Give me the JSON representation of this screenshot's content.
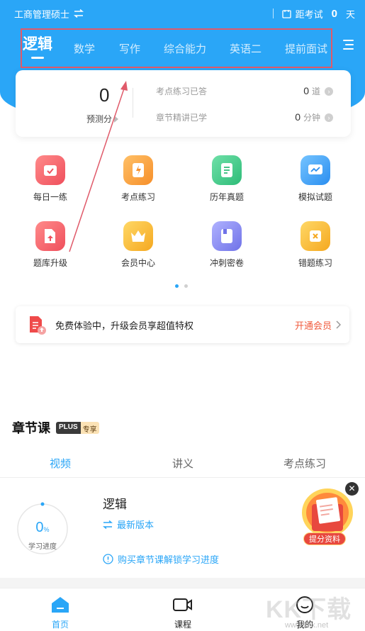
{
  "status_bar": {
    "major": "工商管理硕士",
    "exam_prefix": "距考试",
    "days_left": "0",
    "days_unit": "天"
  },
  "subject_tabs": [
    "逻辑",
    "数学",
    "写作",
    "综合能力",
    "英语二",
    "提前面试"
  ],
  "stats": {
    "predicted_score": "0",
    "predicted_label": "预测分",
    "practice_label": "考点练习已答",
    "practice_value": "0",
    "practice_unit": "道",
    "chapter_label": "章节精讲已学",
    "chapter_value": "0",
    "chapter_unit": "分钟"
  },
  "grid": [
    {
      "label": "每日一练",
      "icon": "calendar-check-icon",
      "color": "#f2626b"
    },
    {
      "label": "考点练习",
      "icon": "lightning-doc-icon",
      "color": "#f6a13a"
    },
    {
      "label": "历年真题",
      "icon": "document-icon",
      "color": "#3cc98a"
    },
    {
      "label": "模拟试题",
      "icon": "chart-screen-icon",
      "color": "#3aa2f5"
    },
    {
      "label": "题库升级",
      "icon": "upgrade-doc-icon",
      "color": "#f2626b"
    },
    {
      "label": "会员中心",
      "icon": "crown-icon",
      "color": "#f6b72a"
    },
    {
      "label": "冲刺密卷",
      "icon": "book-icon",
      "color": "#8a8cf0"
    },
    {
      "label": "错题练习",
      "icon": "cross-box-icon",
      "color": "#f6b72a"
    }
  ],
  "banner": {
    "text": "免费体验中，升级会员享超值特权",
    "button": "开通会员"
  },
  "chapter": {
    "title": "章节课",
    "badge_left": "PLUS",
    "badge_right": "专享",
    "tabs": [
      "视频",
      "讲义",
      "考点练习"
    ],
    "progress_value": "0",
    "progress_unit": "%",
    "progress_label": "学习进度",
    "course_title": "逻辑",
    "version_text": "最新版本",
    "unlock_text": "购买章节课解锁学习进度",
    "promo_label": "提分资料"
  },
  "bottom_nav": [
    "首页",
    "课程",
    "我的"
  ],
  "watermark": {
    "text": "KK下载",
    "url": "www.kkx.net"
  },
  "colors": {
    "primary": "#2aa6f7",
    "accent_orange": "#f05a3c",
    "annotation_red": "#e05a6a"
  }
}
